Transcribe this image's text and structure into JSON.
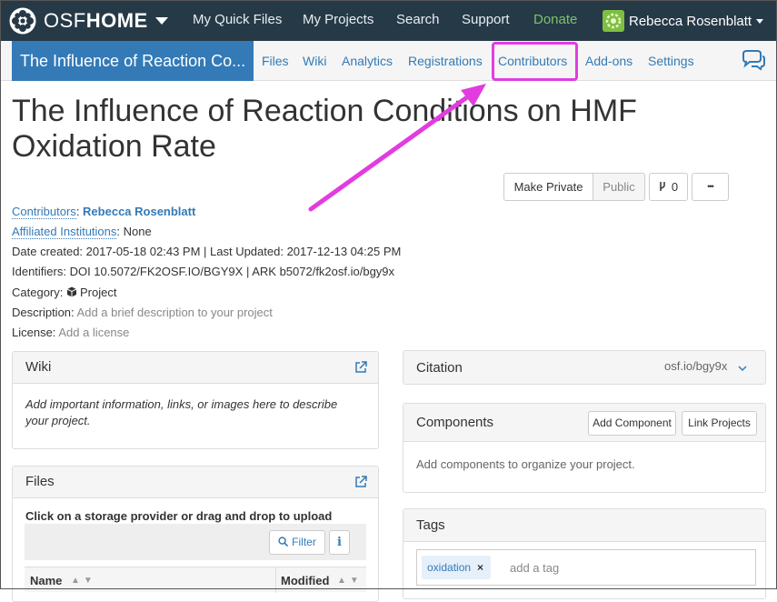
{
  "brand": {
    "name_thin": "OSF",
    "name_bold": "HOME"
  },
  "topnav": {
    "quick_files": "My Quick Files",
    "projects": "My Projects",
    "search": "Search",
    "support": "Support",
    "donate": "Donate",
    "user_name": "Rebecca Rosenblatt"
  },
  "subnav": {
    "project_title": "The Influence of Reaction Co...",
    "files": "Files",
    "wiki": "Wiki",
    "analytics": "Analytics",
    "registrations": "Registrations",
    "contributors": "Contributors",
    "addons": "Add-ons",
    "settings": "Settings"
  },
  "project": {
    "title": "The Influence of Reaction Conditions on HMF Oxidation Rate",
    "make_private_label": "Make Private",
    "public_label": "Public",
    "fork_count": "0",
    "more_label": "•••"
  },
  "meta": {
    "contributors_label": "Contributors",
    "contributor_name": "Rebecca Rosenblatt",
    "affiliated_label": "Affiliated Institutions",
    "affiliated_value": "None",
    "dates": "Date created: 2017-05-18 02:43 PM | Last Updated: 2017-12-13 04:25 PM",
    "identifiers": "Identifiers: DOI 10.5072/FK2OSF.IO/BGY9X | ARK b5072/fk2osf.io/bgy9x",
    "category_label": "Category:",
    "category_value": "Project",
    "description_label": "Description:",
    "description_placeholder": "Add a brief description to your project",
    "license_label": "License:",
    "license_placeholder": "Add a license"
  },
  "wiki_panel": {
    "title": "Wiki",
    "body": "Add important information, links, or images here to describe your project."
  },
  "files_panel": {
    "title": "Files",
    "hint": "Click on a storage provider or drag and drop to upload",
    "filter_label": "Filter",
    "info_label": "i",
    "col_name": "Name",
    "col_modified": "Modified"
  },
  "citation_panel": {
    "title": "Citation",
    "url": "osf.io/bgy9x"
  },
  "components_panel": {
    "title": "Components",
    "add_component": "Add Component",
    "link_projects": "Link Projects",
    "body": "Add components to organize your project."
  },
  "tags_panel": {
    "title": "Tags",
    "tags": [
      "oxidation"
    ],
    "remove_symbol": "×",
    "placeholder": "add a tag"
  },
  "colors": {
    "navbar": "#263947",
    "accent": "#337ab7",
    "donate": "#7cc36b",
    "highlight": "#e23ce0"
  }
}
